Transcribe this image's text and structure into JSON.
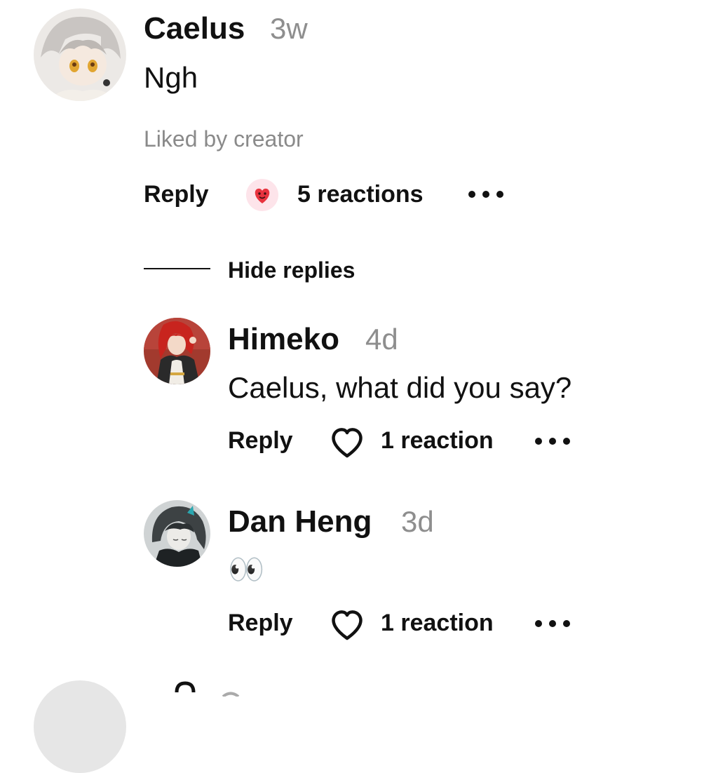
{
  "comment": {
    "author": "Caelus",
    "time": "3w",
    "text": "Ngh",
    "liked_by": "Liked by creator",
    "reply_label": "Reply",
    "reactions_label": "5 reactions",
    "reaction_icon": "heart-face-emoji"
  },
  "thread": {
    "hide_replies_label": "Hide replies"
  },
  "replies": [
    {
      "author": "Himeko",
      "time": "4d",
      "text": "Caelus, what did you say?",
      "reply_label": "Reply",
      "reactions_label": "1 reaction",
      "reaction_icon": "heart-outline-icon"
    },
    {
      "author": "Dan Heng",
      "time": "3d",
      "text": "👀",
      "reply_label": "Reply",
      "reactions_label": "1 reaction",
      "reaction_icon": "heart-outline-icon"
    }
  ],
  "colors": {
    "text": "#111111",
    "muted": "#8e8e8e",
    "reaction_bubble": "#fde4ea",
    "heart_red": "#e8343f"
  }
}
